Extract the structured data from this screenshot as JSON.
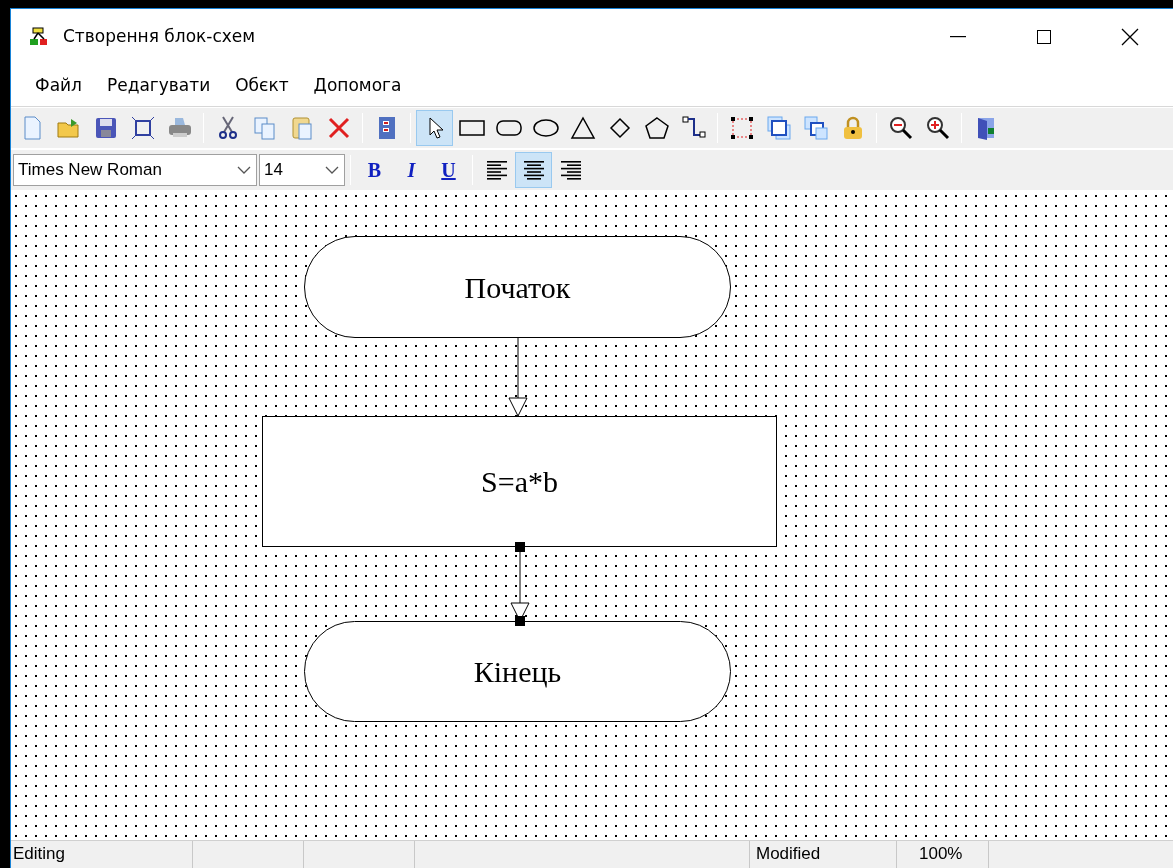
{
  "window": {
    "title": "Створення блок-схем"
  },
  "menu": [
    "Файл",
    "Редагувати",
    "Обєкт",
    "Допомога"
  ],
  "toolbar": [
    [
      {
        "kind": "new"
      },
      {
        "kind": "open"
      },
      {
        "kind": "save"
      },
      {
        "kind": "save-frame"
      },
      {
        "kind": "print"
      }
    ],
    [
      {
        "kind": "cut"
      },
      {
        "kind": "copy"
      },
      {
        "kind": "paste"
      },
      {
        "kind": "delete"
      }
    ],
    [
      {
        "kind": "properties"
      }
    ],
    [
      {
        "kind": "pointer",
        "selected": true
      },
      {
        "kind": "rectangle",
        "selected": false
      },
      {
        "kind": "rounded",
        "selected": false
      },
      {
        "kind": "ellipse",
        "selected": false
      },
      {
        "kind": "triangle",
        "selected": false
      },
      {
        "kind": "diamond",
        "selected": false
      },
      {
        "kind": "pentagon",
        "selected": false
      },
      {
        "kind": "connector",
        "selected": false
      }
    ],
    [
      {
        "kind": "select-area"
      },
      {
        "kind": "bring-front"
      },
      {
        "kind": "send-back"
      },
      {
        "kind": "lock"
      }
    ],
    [
      {
        "kind": "zoom-out"
      },
      {
        "kind": "zoom-in"
      }
    ],
    [
      {
        "kind": "exit"
      }
    ]
  ],
  "format": {
    "font": "Times New Roman",
    "size": "14",
    "bold": "B",
    "italic": "I",
    "underline": "U",
    "align": [
      {
        "kind": "left",
        "selected": false
      },
      {
        "kind": "center",
        "selected": true
      },
      {
        "kind": "right",
        "selected": false
      }
    ]
  },
  "diagram": {
    "nodes": [
      {
        "kind": "terminal",
        "text": "Початок"
      },
      {
        "kind": "process",
        "text": "S=a*b"
      },
      {
        "kind": "terminal",
        "text": "Кінець"
      }
    ],
    "connectors": [
      {
        "selected": false
      },
      {
        "selected": true
      }
    ]
  },
  "status_bar": {
    "mode": "Editing",
    "state": "Modified",
    "zoom": "100%"
  }
}
